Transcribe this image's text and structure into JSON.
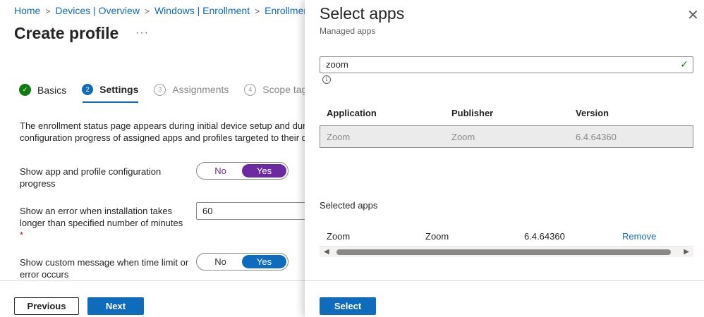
{
  "breadcrumb": {
    "items": [
      "Home",
      "Devices | Overview",
      "Windows | Enrollment",
      "Enrollment"
    ],
    "separator": ">"
  },
  "page": {
    "title": "Create profile",
    "more": "···"
  },
  "steps": [
    {
      "num": "✓",
      "label": "Basics",
      "state": "done"
    },
    {
      "num": "2",
      "label": "Settings",
      "state": "active"
    },
    {
      "num": "3",
      "label": "Assignments",
      "state": "pending"
    },
    {
      "num": "4",
      "label": "Scope tags",
      "state": "pending"
    }
  ],
  "settings": {
    "description_line1": "The enrollment status page appears during initial device setup and during",
    "description_line2": "configuration progress of assigned apps and profiles targeted to their devices.",
    "show_progress": {
      "label": "Show app and profile configuration progress",
      "no": "No",
      "yes": "Yes",
      "value": "Yes"
    },
    "timeout": {
      "label": "Show an error when installation takes longer than specified number of minutes",
      "required": "*",
      "value": "60"
    },
    "custom_message": {
      "label": "Show custom message when time limit or error occurs",
      "no": "No",
      "yes": "Yes",
      "value": "Yes"
    }
  },
  "footer": {
    "previous": "Previous",
    "next": "Next"
  },
  "pane": {
    "title": "Select apps",
    "subtitle": "Managed apps",
    "close": "✕",
    "search_value": "zoom",
    "info": "i",
    "columns": {
      "application": "Application",
      "publisher": "Publisher",
      "version": "Version"
    },
    "results": [
      {
        "application": "Zoom",
        "publisher": "Zoom",
        "version": "6.4.64360"
      }
    ],
    "selected_title": "Selected apps",
    "selected": [
      {
        "application": "Zoom",
        "publisher": "Zoom",
        "version": "6.4.64360",
        "action": "Remove"
      }
    ],
    "select_button": "Select"
  },
  "colors": {
    "accent": "#0f6cbd",
    "toggle_purple": "#6b2aa0",
    "success": "#107c10"
  }
}
